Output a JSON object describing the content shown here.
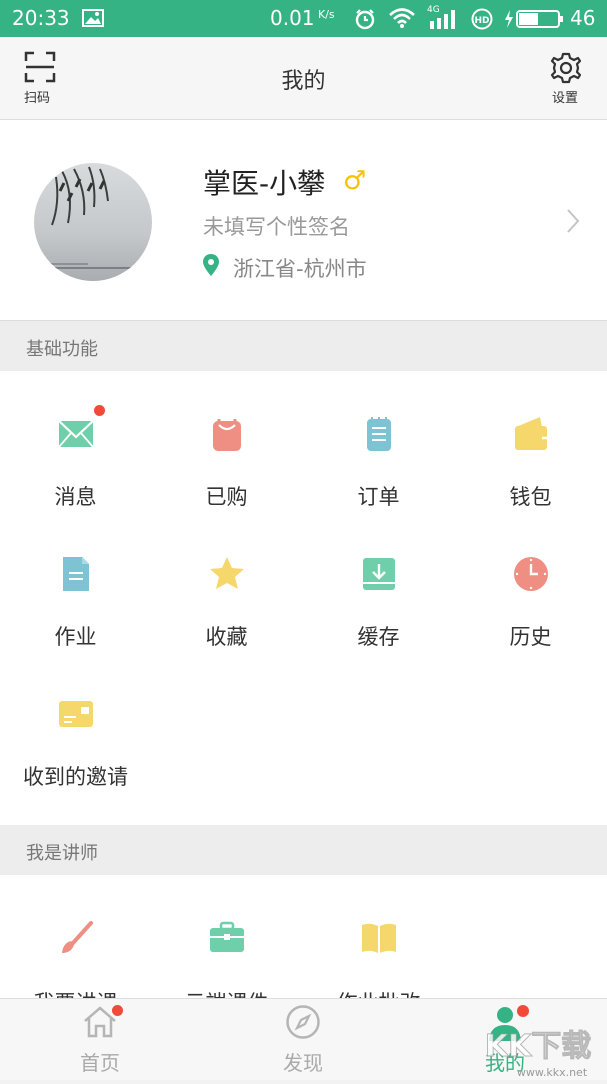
{
  "status_bar": {
    "time": "20:33",
    "speed": "0.01",
    "speed_unit": "K/s",
    "network": "4G",
    "battery": "46"
  },
  "header": {
    "title": "我的",
    "scan_label": "扫码",
    "settings_label": "设置"
  },
  "profile": {
    "name": "掌医-小攀",
    "gender_symbol": "♂",
    "signature": "未填写个性签名",
    "location": "浙江省-杭州市"
  },
  "sections": {
    "basic": {
      "title": "基础功能",
      "items": [
        {
          "label": "消息",
          "icon": "mail-icon",
          "color": "#6fcfaa",
          "badge": true
        },
        {
          "label": "已购",
          "icon": "bag-icon",
          "color": "#ef8e82",
          "badge": false
        },
        {
          "label": "订单",
          "icon": "notepad-icon",
          "color": "#7ec3d4",
          "badge": false
        },
        {
          "label": "钱包",
          "icon": "wallet-icon",
          "color": "#f5d76b",
          "badge": false
        },
        {
          "label": "作业",
          "icon": "document-icon",
          "color": "#7ec3d4",
          "badge": false
        },
        {
          "label": "收藏",
          "icon": "star-icon",
          "color": "#f5d76b",
          "badge": false
        },
        {
          "label": "缓存",
          "icon": "download-icon",
          "color": "#6fcfaa",
          "badge": false
        },
        {
          "label": "历史",
          "icon": "clock-icon",
          "color": "#ef8e82",
          "badge": false
        },
        {
          "label": "收到的邀请",
          "icon": "card-icon",
          "color": "#f5d76b",
          "badge": false
        }
      ]
    },
    "lecturer": {
      "title": "我是讲师",
      "items": [
        {
          "label": "我要讲课",
          "icon": "brush-icon",
          "color": "#ef8e82"
        },
        {
          "label": "云端课件",
          "icon": "briefcase-icon",
          "color": "#6fcfaa"
        },
        {
          "label": "作业批改",
          "icon": "book-icon",
          "color": "#f5d76b"
        }
      ]
    }
  },
  "bottom_nav": {
    "items": [
      {
        "label": "首页",
        "icon": "home-icon",
        "active": false,
        "badge": true
      },
      {
        "label": "发现",
        "icon": "compass-icon",
        "active": false,
        "badge": false
      },
      {
        "label": "我的",
        "icon": "person-icon",
        "active": true,
        "badge": true
      }
    ],
    "active_color": "#36b385"
  },
  "watermark": {
    "text": "KK下载",
    "url": "www.kkx.net"
  }
}
